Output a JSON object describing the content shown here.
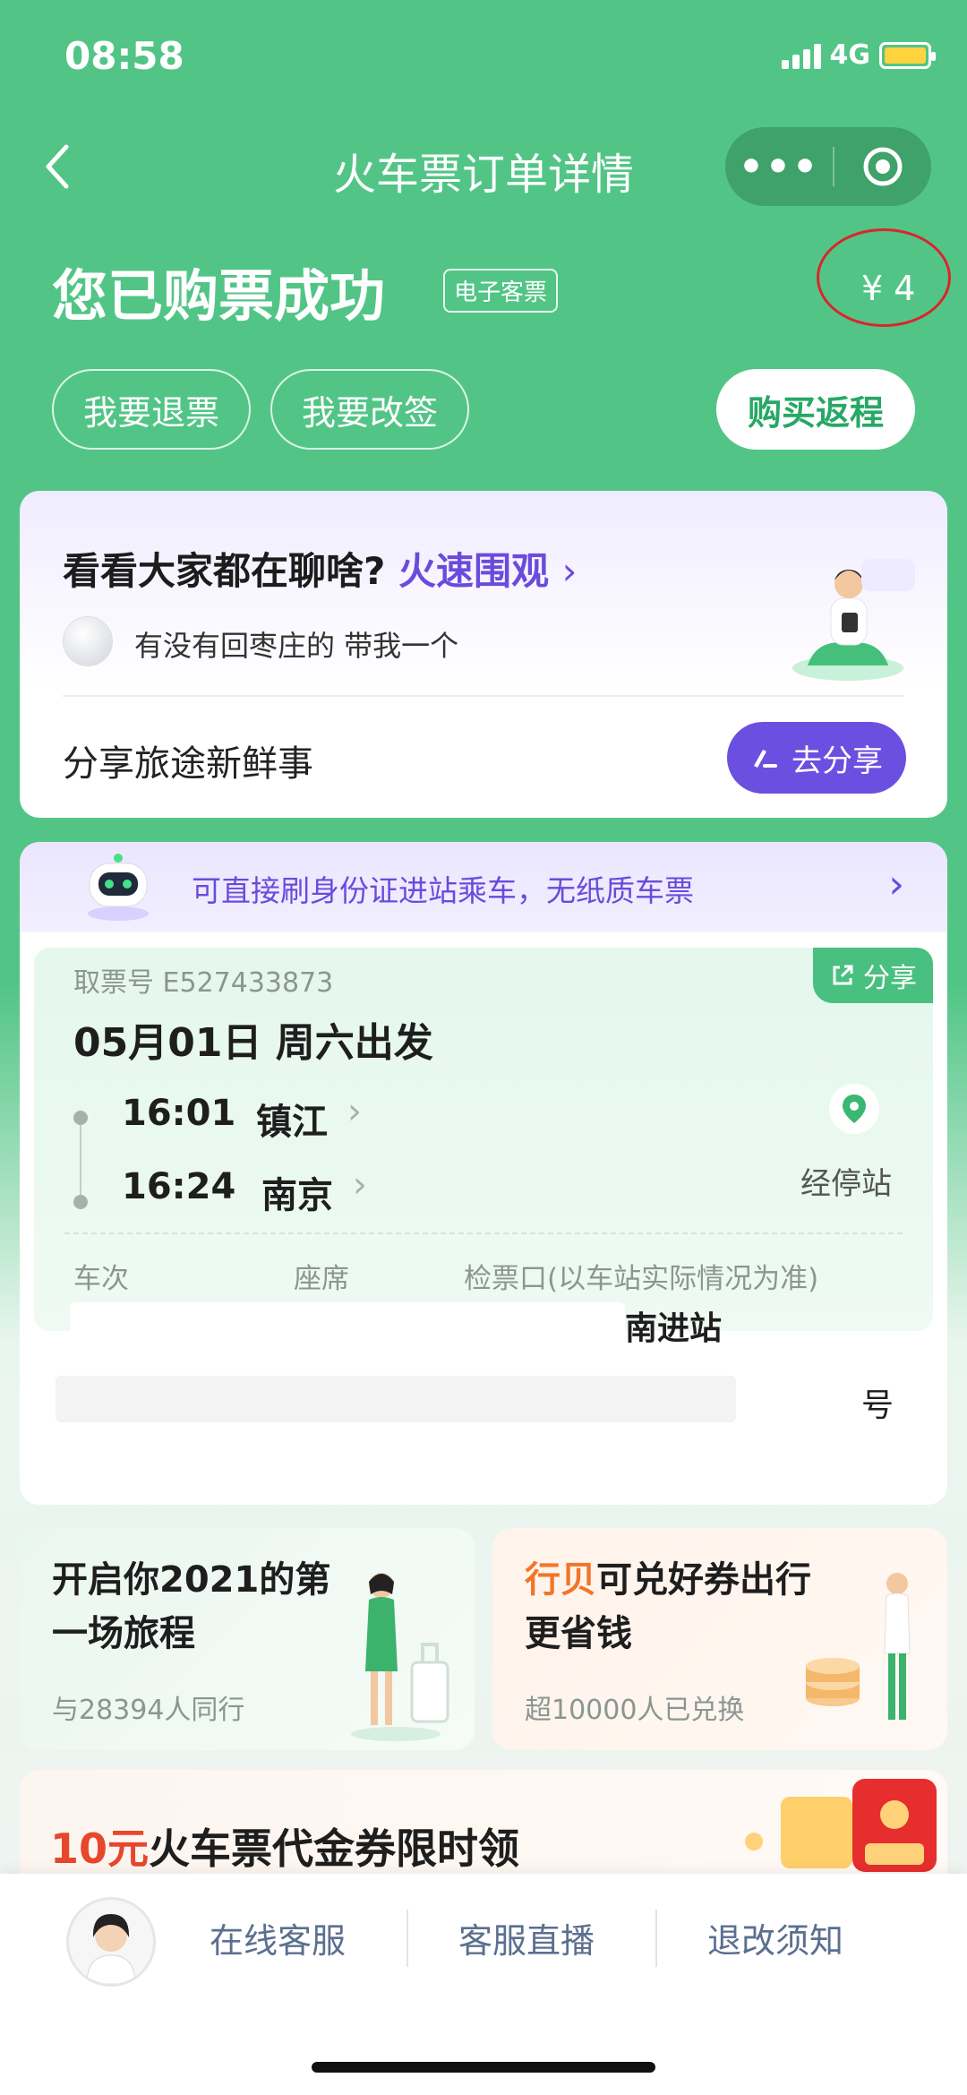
{
  "status_bar": {
    "time": "08:58",
    "network": "4G"
  },
  "nav": {
    "title": "火车票订单详情",
    "more": "•••"
  },
  "header": {
    "success_title": "您已购票成功",
    "eticket_badge": "电子客票",
    "price": "¥ 4",
    "actions": {
      "refund": "我要退票",
      "change": "我要改签",
      "buy_return": "购买返程"
    }
  },
  "community": {
    "title": "看看大家都在聊啥?",
    "link": "火速围观",
    "chat_preview": "有没有回枣庄的 带我一个",
    "share_prompt": "分享旅途新鲜事",
    "share_button": "去分享"
  },
  "ticket": {
    "notice": "可直接刷身份证进站乘车，无纸质车票",
    "pickup_no": "取票号 E527433873",
    "share": "分享",
    "depart_date": "05月01日 周六出发",
    "from": {
      "time": "16:01",
      "station": "镇江"
    },
    "to": {
      "time": "16:24",
      "station": "南京"
    },
    "stops_label": "经停站",
    "columns": {
      "train": "车次",
      "seat": "座席",
      "gate": "检票口(以车站实际情况为准)"
    },
    "gate_value": "南进站",
    "seat_number_suffix": "号"
  },
  "promos": [
    {
      "title": "开启你2021的第一场旅程",
      "subtitle": "与28394人同行"
    },
    {
      "accent": "行贝",
      "title": "可兑好券出行更省钱",
      "subtitle": "超10000人已兑换"
    }
  ],
  "voucher": {
    "red": "10元",
    "title": "火车票代金券限时领"
  },
  "bottom_bar": {
    "online_service": "在线客服",
    "live": "客服直播",
    "policy": "退改须知"
  },
  "colors": {
    "brand_green": "#52c586",
    "accent_purple": "#6a4bdc",
    "price_circle": "#d9262e"
  }
}
